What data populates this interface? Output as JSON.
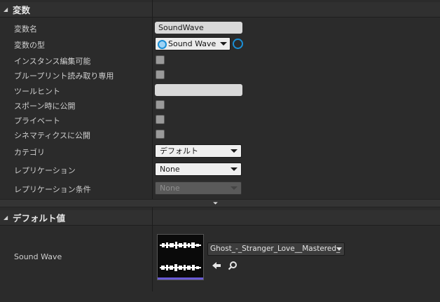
{
  "variables_section": {
    "title": "変数",
    "rows": {
      "var_name": {
        "label": "変数名",
        "value": "SoundWave"
      },
      "var_type": {
        "label": "変数の型",
        "value": "Sound Wave"
      },
      "instance_editable": {
        "label": "インスタンス編集可能",
        "checked": false
      },
      "blueprint_readonly": {
        "label": "ブループリント読み取り専用",
        "checked": false
      },
      "tooltip": {
        "label": "ツールヒント",
        "value": ""
      },
      "expose_on_spawn": {
        "label": "スポーン時に公開",
        "checked": false
      },
      "private": {
        "label": "プライベート",
        "checked": false
      },
      "expose_cinematics": {
        "label": "シネマティクスに公開",
        "checked": false
      },
      "category": {
        "label": "カテゴリ",
        "value": "デフォルト"
      },
      "replication": {
        "label": "レプリケーション",
        "value": "None"
      },
      "replication_condition": {
        "label": "レプリケーション条件",
        "value": "None"
      }
    }
  },
  "default_section": {
    "title": "デフォルト値",
    "sound_wave": {
      "label": "Sound Wave",
      "asset": "Ghost_-_Stranger_Love__Mastered_"
    }
  },
  "icons": [
    "collapse-arrow-icon",
    "expand-more-icon",
    "use-selected-arrow-icon",
    "browse-magnifier-icon",
    "variable-pin-icon",
    "container-type-icon"
  ],
  "colors": {
    "pin_blue": "#1a8fd6",
    "thumb_bar": "#6a5bd6"
  }
}
